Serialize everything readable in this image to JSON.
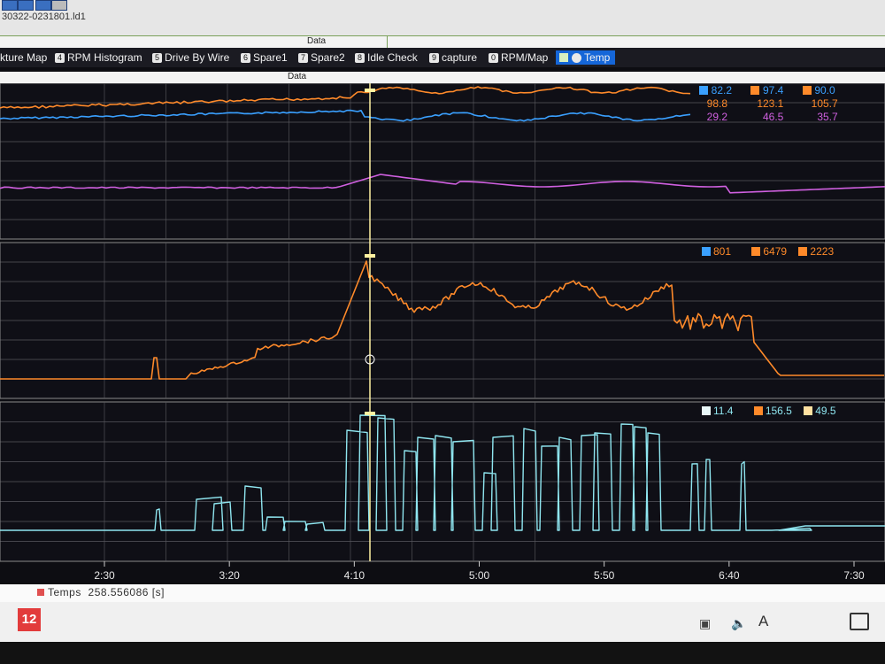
{
  "window": {
    "filename": "30322-0231801.ld1",
    "data_header_top": "Data",
    "data_header_panel": "Data"
  },
  "tabs": [
    {
      "num": "",
      "label": "kture Map"
    },
    {
      "num": "4",
      "label": "RPM Histogram"
    },
    {
      "num": "5",
      "label": "Drive By Wire"
    },
    {
      "num": "6",
      "label": "Spare1"
    },
    {
      "num": "7",
      "label": "Spare2"
    },
    {
      "num": "8",
      "label": "Idle Check"
    },
    {
      "num": "9",
      "label": "capture"
    },
    {
      "num": "0",
      "label": "RPM/Map"
    },
    {
      "num": "",
      "label": "Temp",
      "active": true
    }
  ],
  "legends": {
    "panel1": {
      "header": [
        "82.2",
        "97.4",
        "90.0"
      ],
      "row2": [
        "98.8",
        "123.1",
        "105.7"
      ],
      "row3": [
        "29.2",
        "46.5",
        "35.7"
      ]
    },
    "panel2": {
      "header": [
        "801",
        "6479",
        "2223"
      ]
    },
    "panel3": {
      "header": [
        "11.4",
        "156.5",
        "49.5"
      ]
    }
  },
  "time_axis": {
    "ticks": [
      "2:30",
      "3:20",
      "4:10",
      "5:00",
      "5:50",
      "6:40",
      "7:30"
    ]
  },
  "cursor": {
    "time_s": 258.556086
  },
  "status": {
    "channel": "Temps",
    "time": "258.556086 [s]"
  },
  "colors": {
    "orange": "#ff8a2a",
    "blue": "#3aa0ff",
    "magenta": "#d060e0",
    "cyan": "#8fe6f0",
    "cursor": "#fff2a0",
    "tab_active": "#1566d8"
  },
  "icons": {
    "app": "speedo-app-icon",
    "tray": [
      "network-icon",
      "volume-icon",
      "ime-icon",
      "notification-icon"
    ]
  },
  "taskbar": {
    "app_label": "12",
    "ime_label": "A"
  }
}
